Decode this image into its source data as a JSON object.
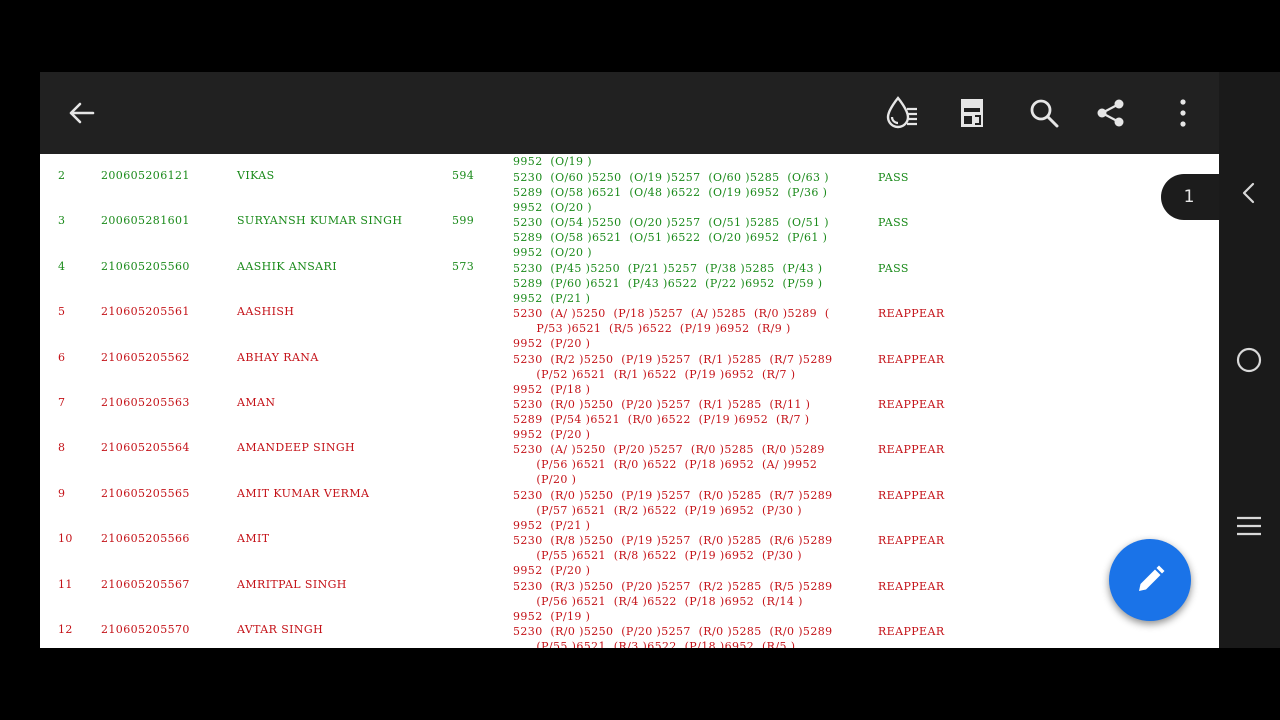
{
  "page_badge": "1",
  "toolbar": {
    "back_icon": "arrow-left-icon",
    "icons": [
      "ink-drop-lines-icon",
      "page-layout-icon",
      "search-icon",
      "share-icon",
      "more-vert-icon"
    ]
  },
  "colors": {
    "pass": "#1a8a1a",
    "reappear": "#c41218",
    "toolbar": "#212121",
    "fab": "#1a73e8"
  },
  "top_fragment": {
    "line": "9952  (O/19 )"
  },
  "rows": [
    {
      "sn": "2",
      "roll": "200605206121",
      "name": "VIKAS",
      "marks": "594",
      "result": "PASS",
      "status": "pass",
      "lines": [
        "5230  (O/60 )5250  (O/19 )5257  (O/60 )5285  (O/63 )",
        "5289  (O/58 )6521  (O/48 )6522  (O/19 )6952  (P/36 )",
        "9952  (O/20 )"
      ]
    },
    {
      "sn": "3",
      "roll": "200605281601",
      "name": "SURYANSH KUMAR SINGH",
      "marks": "599",
      "result": "PASS",
      "status": "pass",
      "lines": [
        "5230  (O/54 )5250  (O/20 )5257  (O/51 )5285  (O/51 )",
        "5289  (O/58 )6521  (O/51 )6522  (O/20 )6952  (P/61 )",
        "9952  (O/20 )"
      ]
    },
    {
      "sn": "4",
      "roll": "210605205560",
      "name": "AASHIK ANSARI",
      "marks": "573",
      "result": "PASS",
      "status": "pass",
      "lines": [
        "5230  (P/45 )5250  (P/21 )5257  (P/38 )5285  (P/43 )",
        "5289  (P/60 )6521  (P/43 )6522  (P/22 )6952  (P/59 )",
        "9952  (P/21 )"
      ]
    },
    {
      "sn": "5",
      "roll": "210605205561",
      "name": "AASHISH",
      "marks": "",
      "result": "REAPPEAR",
      "status": "reappear",
      "lines": [
        "5230  (A/ )5250  (P/18 )5257  (A/ )5285  (R/0 )5289  (",
        "      P/53 )6521  (R/5 )6522  (P/19 )6952  (R/9 )",
        "9952  (P/20 )"
      ]
    },
    {
      "sn": "6",
      "roll": "210605205562",
      "name": "ABHAY RANA",
      "marks": "",
      "result": "REAPPEAR",
      "status": "reappear",
      "lines": [
        "5230  (R/2 )5250  (P/19 )5257  (R/1 )5285  (R/7 )5289",
        "      (P/52 )6521  (R/1 )6522  (P/19 )6952  (R/7 )",
        "9952  (P/18 )"
      ]
    },
    {
      "sn": "7",
      "roll": "210605205563",
      "name": "AMAN",
      "marks": "",
      "result": "REAPPEAR",
      "status": "reappear",
      "lines": [
        "5230  (R/0 )5250  (P/20 )5257  (R/1 )5285  (R/11 )",
        "5289  (P/54 )6521  (R/0 )6522  (P/19 )6952  (R/7 )",
        "9952  (P/20 )"
      ]
    },
    {
      "sn": "8",
      "roll": "210605205564",
      "name": "AMANDEEP SINGH",
      "marks": "",
      "result": "REAPPEAR",
      "status": "reappear",
      "lines": [
        "5230  (A/ )5250  (P/20 )5257  (R/0 )5285  (R/0 )5289",
        "      (P/56 )6521  (R/0 )6522  (P/18 )6952  (A/ )9952",
        "      (P/20 )"
      ]
    },
    {
      "sn": "9",
      "roll": "210605205565",
      "name": "AMIT KUMAR VERMA",
      "marks": "",
      "result": "REAPPEAR",
      "status": "reappear",
      "lines": [
        "5230  (R/0 )5250  (P/19 )5257  (R/0 )5285  (R/7 )5289",
        "      (P/57 )6521  (R/2 )6522  (P/19 )6952  (P/30 )",
        "9952  (P/21 )"
      ]
    },
    {
      "sn": "10",
      "roll": "210605205566",
      "name": "AMIT",
      "marks": "",
      "result": "REAPPEAR",
      "status": "reappear",
      "lines": [
        "5230  (R/8 )5250  (P/19 )5257  (R/0 )5285  (R/6 )5289",
        "      (P/55 )6521  (R/8 )6522  (P/19 )6952  (P/30 )",
        "9952  (P/20 )"
      ]
    },
    {
      "sn": "11",
      "roll": "210605205567",
      "name": "AMRITPAL SINGH",
      "marks": "",
      "result": "REAPPEAR",
      "status": "reappear",
      "lines": [
        "5230  (R/3 )5250  (P/20 )5257  (R/2 )5285  (R/5 )5289",
        "      (P/56 )6521  (R/4 )6522  (P/18 )6952  (R/14 )",
        "9952  (P/19 )"
      ]
    },
    {
      "sn": "12",
      "roll": "210605205570",
      "name": "AVTAR SINGH",
      "marks": "",
      "result": "REAPPEAR",
      "status": "reappear",
      "lines": [
        "5230  (R/0 )5250  (P/20 )5257  (R/0 )5285  (R/0 )5289",
        "      (P/55 )6521  (R/3 )6522  (P/18 )6952  (R/5 )"
      ]
    }
  ],
  "nav": {
    "icons": [
      "nav-back-icon",
      "nav-home-icon",
      "nav-recents-icon"
    ]
  },
  "fab_icon": "pencil-icon"
}
